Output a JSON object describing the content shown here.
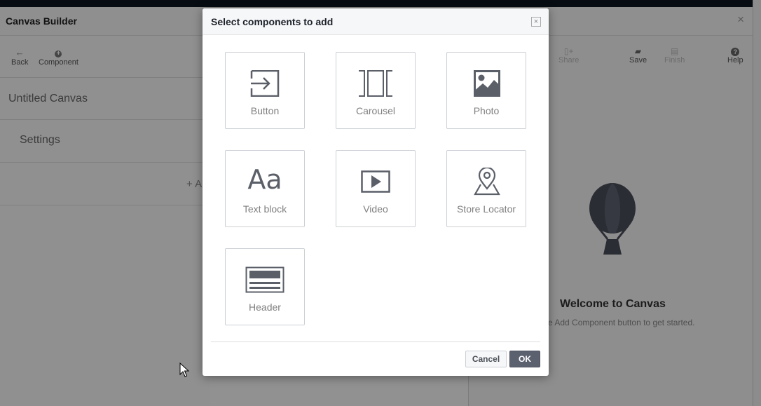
{
  "app": {
    "title": "Canvas Builder",
    "close_glyph": "×",
    "toolbar_left": [
      {
        "icon": "arrow-left-icon",
        "label": "Back"
      },
      {
        "icon": "plus-circle-icon",
        "label": "Component"
      }
    ],
    "canvas_name": "Untitled Canvas",
    "settings_label": "Settings",
    "add_row_label": "+ A",
    "toolbar_right": [
      {
        "icon": "share-icon",
        "label": "Share",
        "enabled": false
      },
      {
        "icon": "folder-icon",
        "label": "Save",
        "enabled": true
      },
      {
        "icon": "finish-icon",
        "label": "Finish",
        "enabled": false
      },
      {
        "icon": "help-icon",
        "label": "Help",
        "enabled": true
      }
    ],
    "welcome_title": "Welcome to Canvas",
    "welcome_text": "e Add Component button to get started."
  },
  "modal": {
    "title": "Select components to add",
    "close_glyph": "×",
    "components": [
      {
        "icon": "button-icon",
        "label": "Button"
      },
      {
        "icon": "carousel-icon",
        "label": "Carousel"
      },
      {
        "icon": "photo-icon",
        "label": "Photo"
      },
      {
        "icon": "text-block-icon",
        "label": "Text block",
        "glyph": "Aa"
      },
      {
        "icon": "video-icon",
        "label": "Video"
      },
      {
        "icon": "store-locator-icon",
        "label": "Store Locator"
      },
      {
        "icon": "header-icon",
        "label": "Header"
      }
    ],
    "cancel_label": "Cancel",
    "ok_label": "OK"
  },
  "colors": {
    "icon": "#5b5f68",
    "ok_button": "#5c6170",
    "tile_border": "#ccd0d5"
  }
}
